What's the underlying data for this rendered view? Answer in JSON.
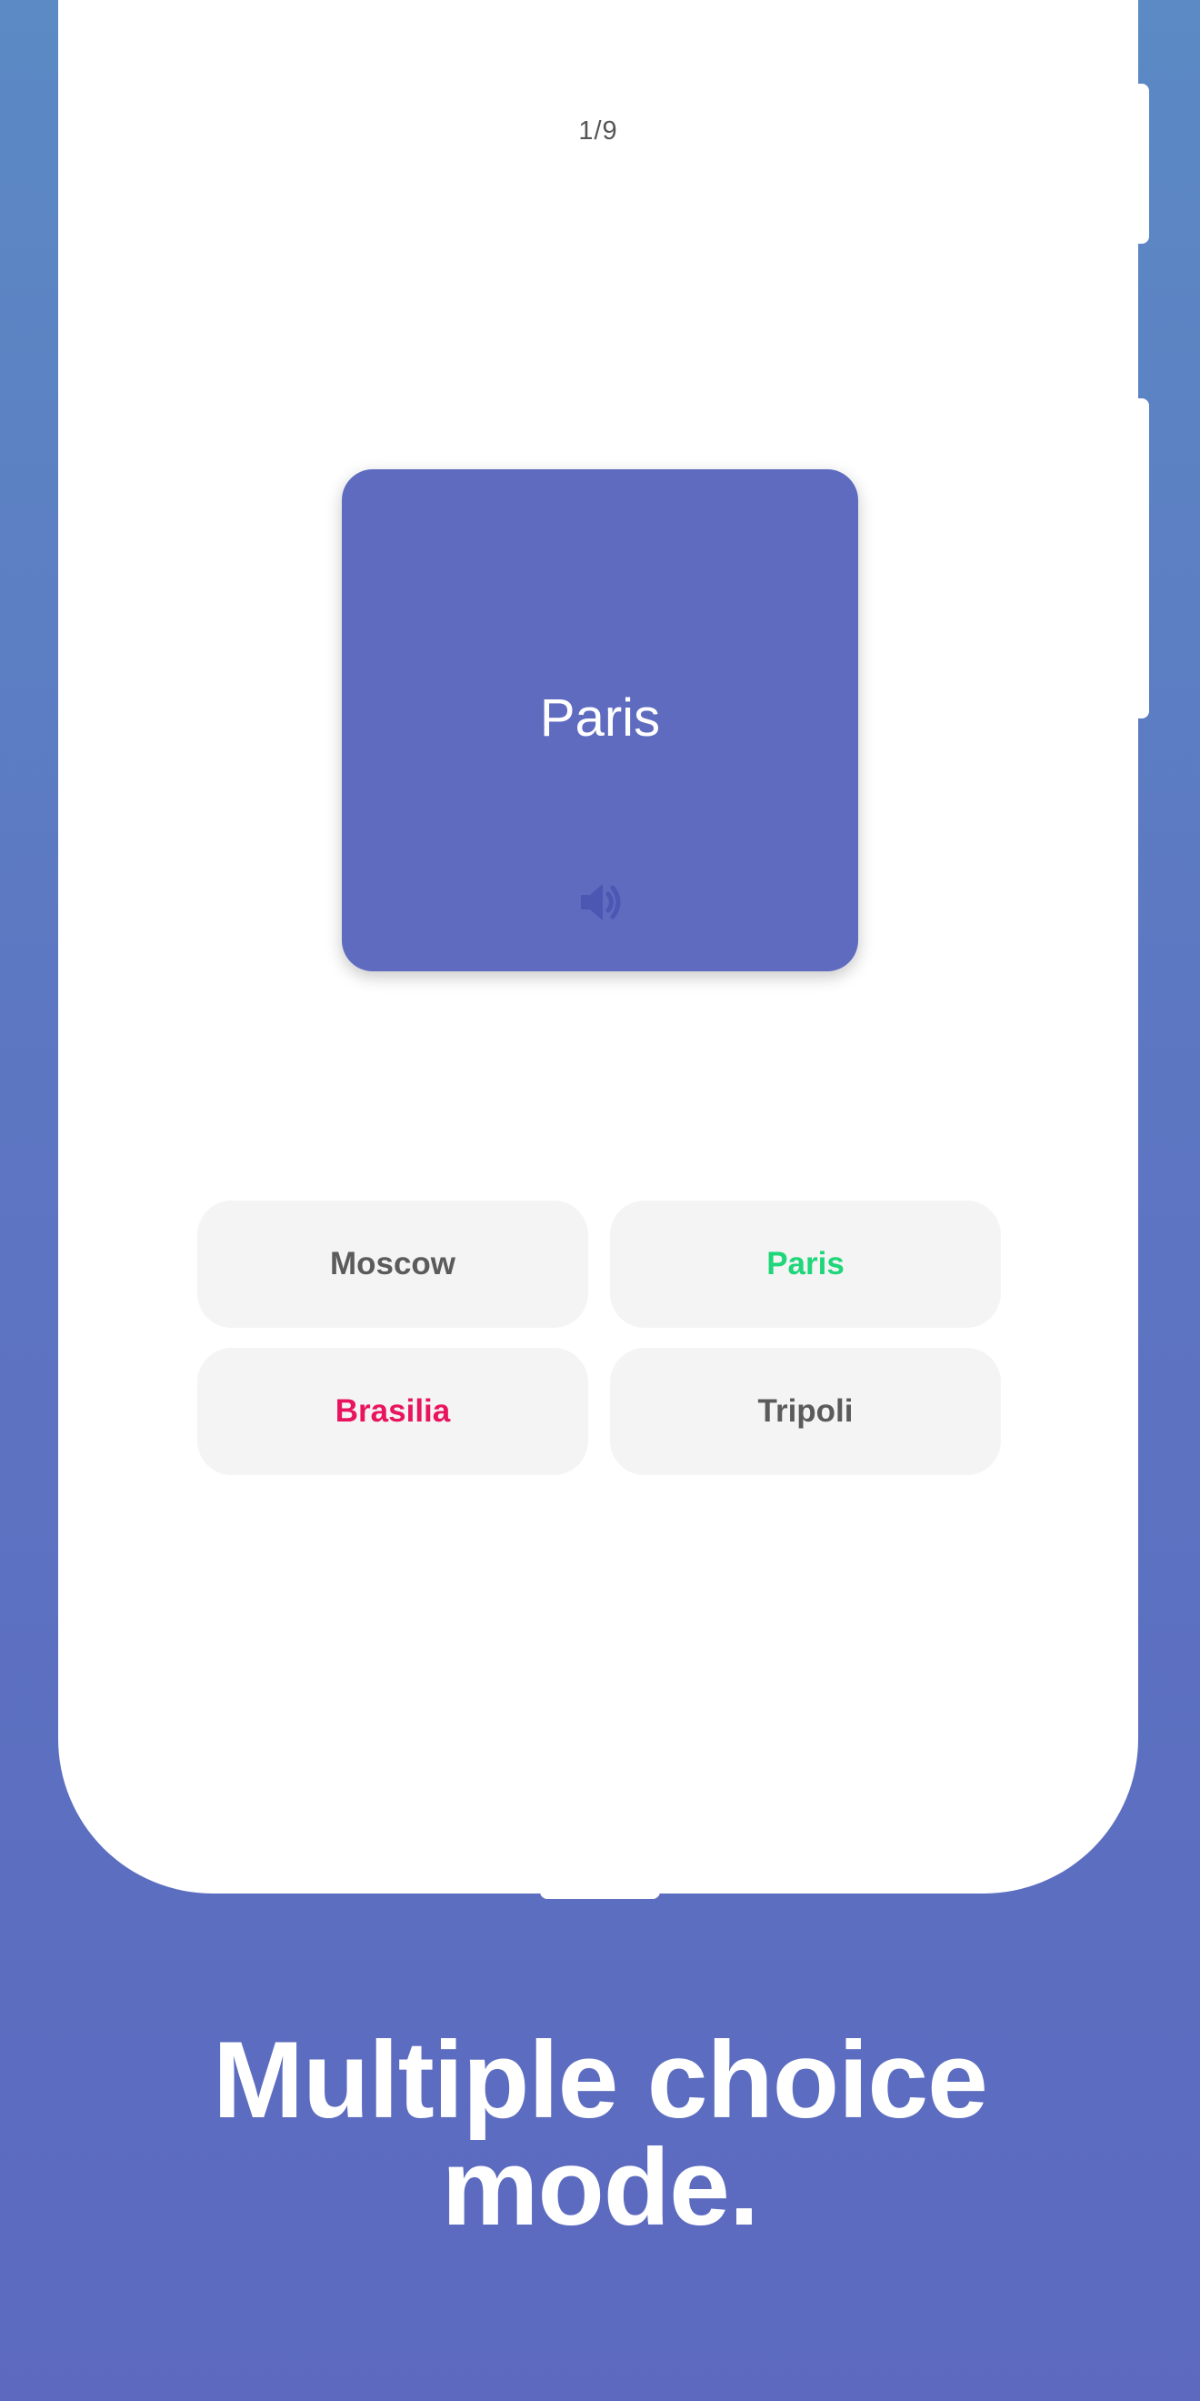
{
  "quiz": {
    "progress": "1/9",
    "card": {
      "term": "Paris",
      "color": "#5f6bbf",
      "audio_icon": "speaker-icon"
    },
    "choices": [
      {
        "label": "Moscow",
        "state": "neutral"
      },
      {
        "label": "Paris",
        "state": "correct"
      },
      {
        "label": "Brasilia",
        "state": "wrong"
      },
      {
        "label": "Tripoli",
        "state": "neutral"
      }
    ],
    "colors": {
      "correct": "#1fd67a",
      "wrong": "#e8155e",
      "neutral": "#5b5b5b"
    }
  },
  "promo": {
    "headline_line1": "Multiple choice",
    "headline_line2": "mode."
  }
}
